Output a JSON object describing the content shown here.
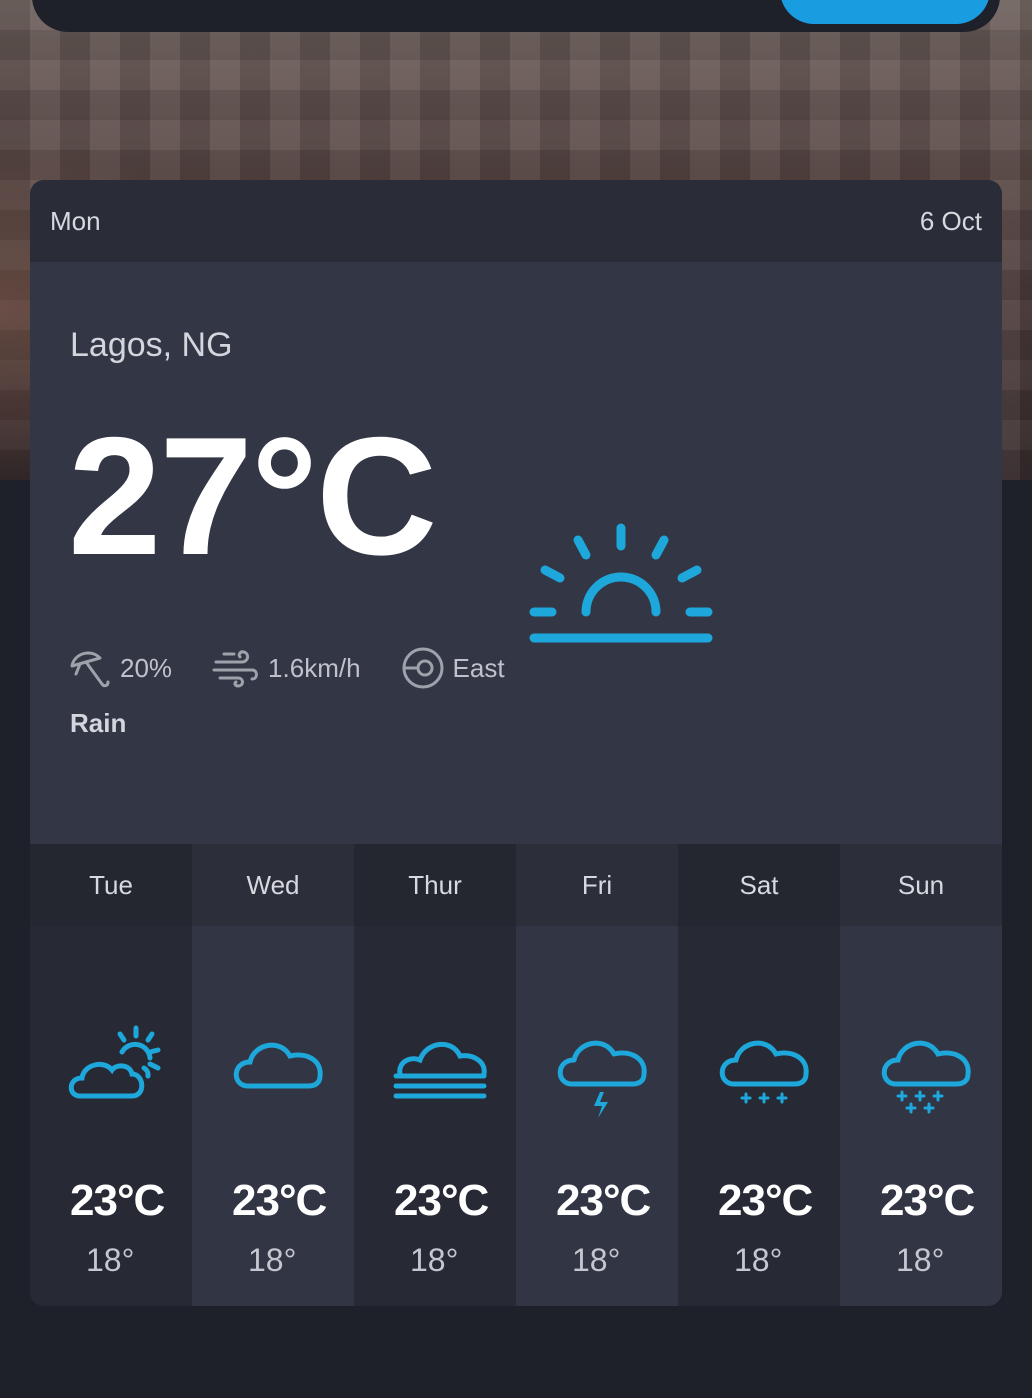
{
  "header": {
    "day": "Mon",
    "date": "6 Oct"
  },
  "current": {
    "location": "Lagos, NG",
    "temperature": "27°C",
    "icon": "sunrise-icon",
    "precipitation": "20%",
    "wind_speed": "1.6km/h",
    "wind_direction": "East",
    "description": "Rain"
  },
  "forecast": [
    {
      "day": "Tue",
      "high": "23°C",
      "low": "18°",
      "icon": "partly-cloudy-icon"
    },
    {
      "day": "Wed",
      "high": "23°C",
      "low": "18°",
      "icon": "cloud-icon"
    },
    {
      "day": "Thur",
      "high": "23°C",
      "low": "18°",
      "icon": "fog-icon"
    },
    {
      "day": "Fri",
      "high": "23°C",
      "low": "18°",
      "icon": "thunder-icon"
    },
    {
      "day": "Sat",
      "high": "23°C",
      "low": "18°",
      "icon": "light-snow-icon"
    },
    {
      "day": "Sun",
      "high": "23°C",
      "low": "18°",
      "icon": "snow-icon"
    }
  ],
  "colors": {
    "accent": "#1ea7db",
    "card": "#2e313d",
    "background": "#1e202a"
  }
}
